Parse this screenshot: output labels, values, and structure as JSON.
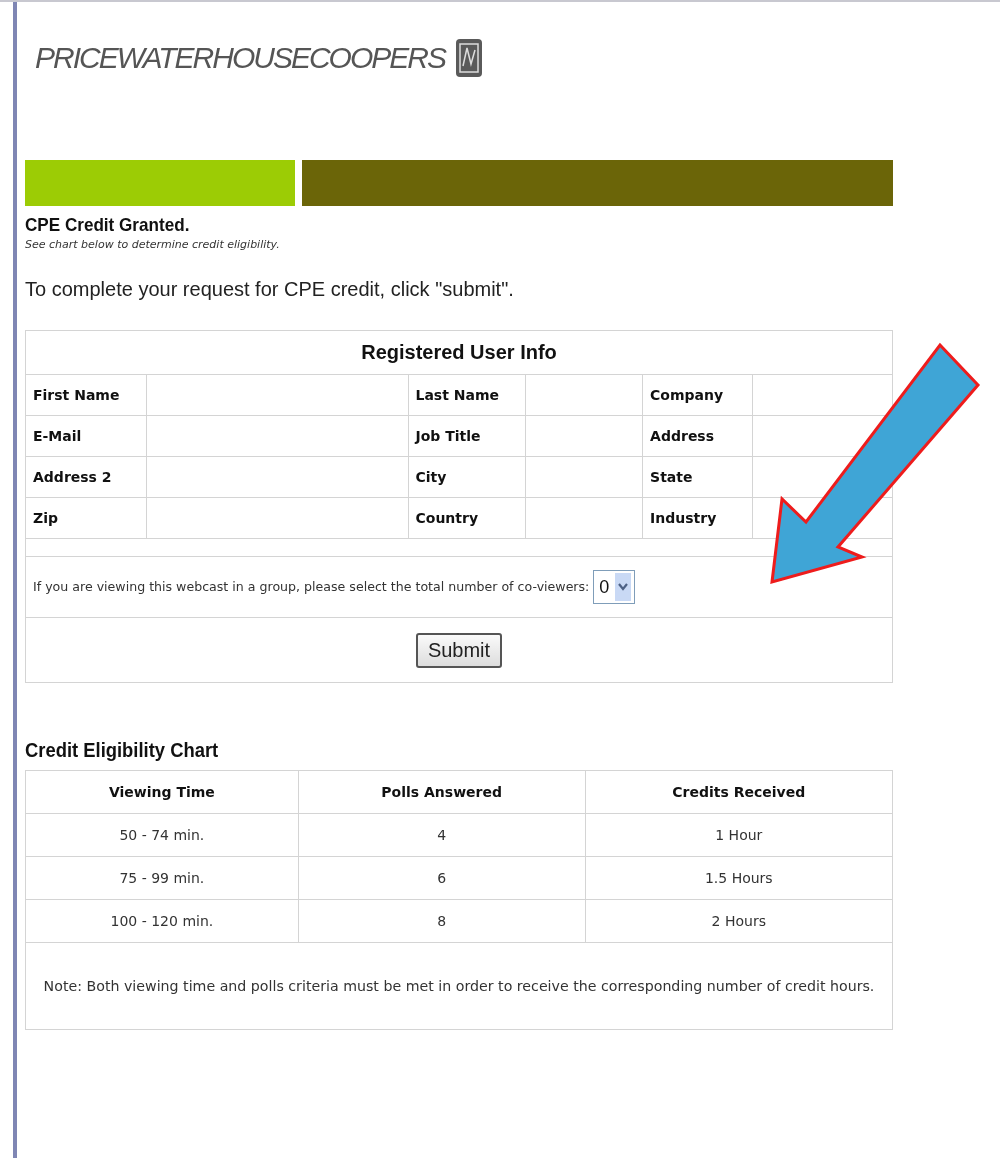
{
  "logo": {
    "text": "PRICEWATERHOUSECOOPERS"
  },
  "status": {
    "title": "CPE Credit Granted.",
    "subtitle": "See chart below to determine credit eligibility.",
    "instruction": "To complete your request for CPE credit, click \"submit\"."
  },
  "user_info": {
    "title": "Registered User Info",
    "rows": [
      [
        "First Name",
        "Last Name",
        "Company"
      ],
      [
        "E-Mail",
        "Job Title",
        "Address"
      ],
      [
        "Address 2",
        "City",
        "State"
      ],
      [
        "Zip",
        "Country",
        "Industry"
      ]
    ],
    "coviewers": {
      "label": "If you are viewing this webcast in a group, please select the total number of co-viewers:",
      "value": "0"
    },
    "submit": "Submit"
  },
  "eligibility": {
    "title": "Credit Eligibility Chart",
    "columns": [
      "Viewing Time",
      "Polls Answered",
      "Credits Received"
    ],
    "rows": [
      [
        "50 - 74 min.",
        "4",
        "1 Hour"
      ],
      [
        "75 - 99 min.",
        "6",
        "1.5 Hours"
      ],
      [
        "100 - 120 min.",
        "8",
        "2 Hours"
      ]
    ],
    "note": "Note: Both viewing time and polls criteria must be met in order to receive the corresponding number of credit hours."
  }
}
